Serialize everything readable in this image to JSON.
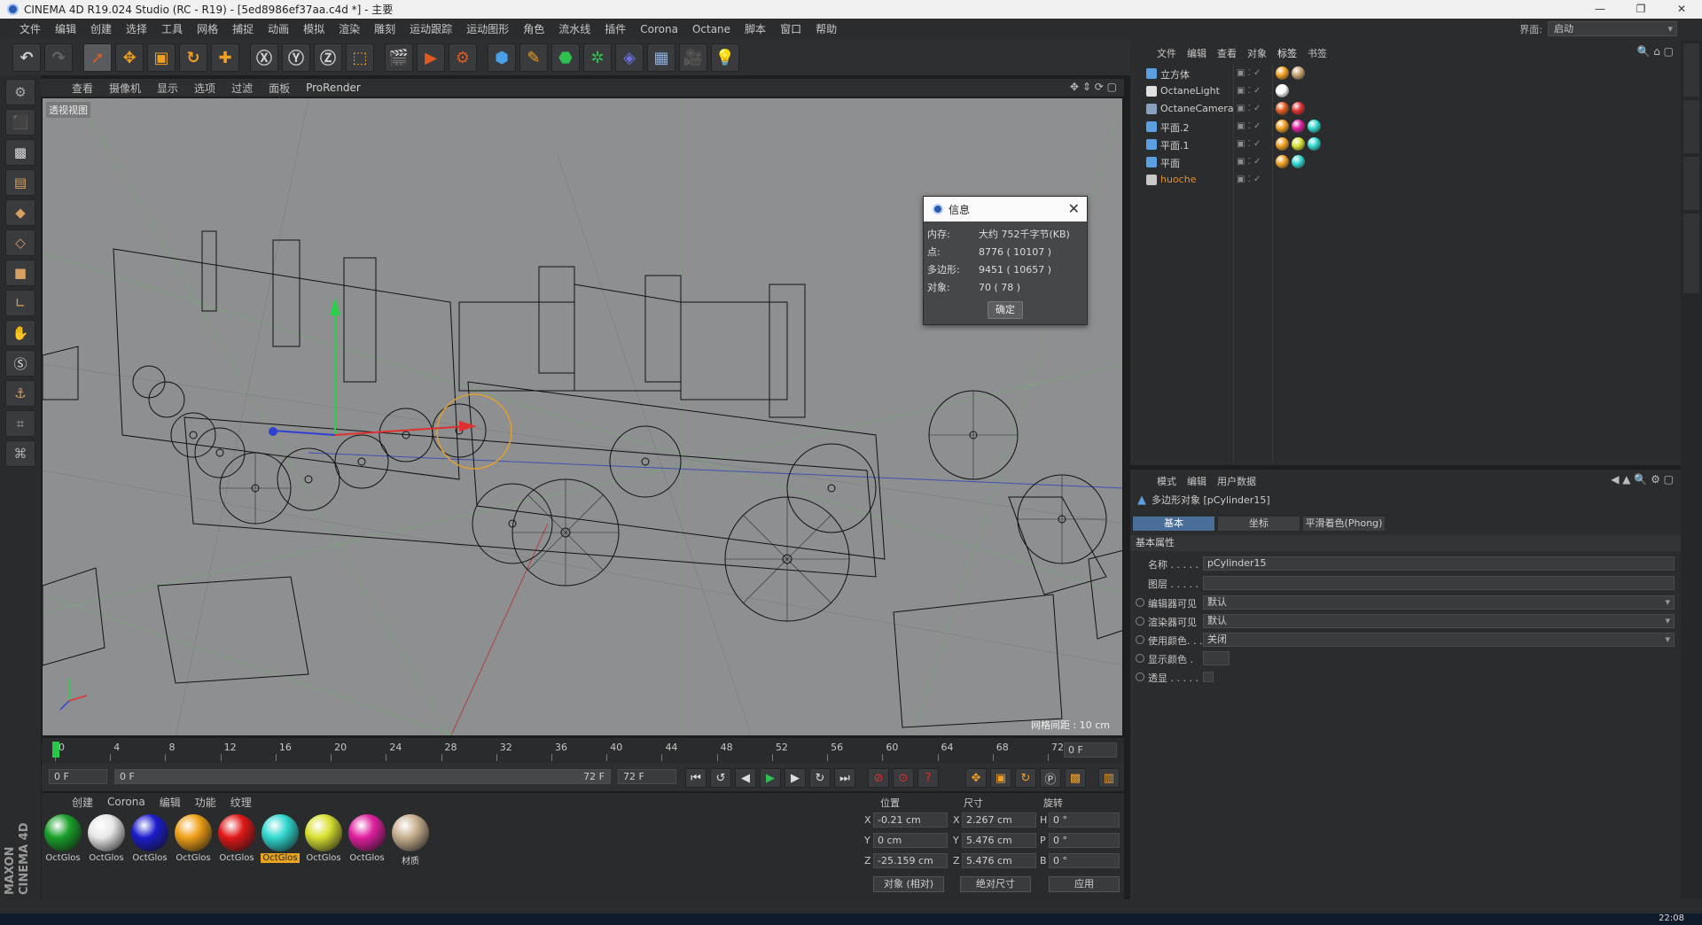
{
  "window": {
    "title": "CINEMA 4D R19.024 Studio (RC - R19) - [5ed8986ef37aa.c4d *] - 主要",
    "min": "—",
    "max": "❐",
    "close": "✕"
  },
  "menubar": {
    "items": [
      "文件",
      "编辑",
      "创建",
      "选择",
      "工具",
      "网格",
      "捕捉",
      "动画",
      "模拟",
      "渲染",
      "雕刻",
      "运动跟踪",
      "运动图形",
      "角色",
      "流水线",
      "插件",
      "Corona",
      "Octane",
      "脚本",
      "窗口",
      "帮助"
    ],
    "layout_label": "界面:",
    "layout_value": "启动"
  },
  "viewport": {
    "menu": [
      "查看",
      "摄像机",
      "显示",
      "选项",
      "过滤",
      "面板",
      "ProRender"
    ],
    "label": "透视视图",
    "grid_spacing": "网格间距 : 10 cm"
  },
  "dialog": {
    "title": "信息",
    "rows": [
      {
        "k": "内存:",
        "v": "大约 752千字节(KB)"
      },
      {
        "k": "点:",
        "v": "8776 ( 10107 )"
      },
      {
        "k": "多边形:",
        "v": "9451 ( 10657 )"
      },
      {
        "k": "对象:",
        "v": "70 ( 78 )"
      }
    ],
    "ok": "确定"
  },
  "timeline": {
    "ticks": [
      "0",
      "4",
      "8",
      "12",
      "16",
      "20",
      "24",
      "28",
      "32",
      "36",
      "40",
      "44",
      "48",
      "52",
      "56",
      "60",
      "64",
      "68",
      "72"
    ],
    "current_frame": "0 F",
    "start": "0 F",
    "range_start": "0 F",
    "range_end": "72 F",
    "end": "72 F"
  },
  "materials": {
    "menu": [
      "创建",
      "Corona",
      "编辑",
      "功能",
      "纹理"
    ],
    "items": [
      {
        "label": "OctGlos",
        "color": "#19a02a"
      },
      {
        "label": "OctGlos",
        "color": "#e8e8e8"
      },
      {
        "label": "OctGlos",
        "color": "#1c1ccc"
      },
      {
        "label": "OctGlos",
        "color": "#f0a018"
      },
      {
        "label": "OctGlos",
        "color": "#e01818"
      },
      {
        "label": "OctGlos",
        "color": "#30d8d0",
        "selected": true
      },
      {
        "label": "OctGlos",
        "color": "#d8e030"
      },
      {
        "label": "OctGlos",
        "color": "#e020a0"
      },
      {
        "label": "材质",
        "color": "#c8b090"
      }
    ]
  },
  "coords": {
    "headers": [
      "位置",
      "尺寸",
      "旋转"
    ],
    "rows": [
      {
        "a": "X",
        "pos": "-0.21 cm",
        "b": "X",
        "size": "2.267 cm",
        "c": "H",
        "rot": "0 °"
      },
      {
        "a": "Y",
        "pos": "0 cm",
        "b": "Y",
        "size": "5.476 cm",
        "c": "P",
        "rot": "0 °"
      },
      {
        "a": "Z",
        "pos": "-25.159 cm",
        "b": "Z",
        "size": "5.476 cm",
        "c": "B",
        "rot": "0 °"
      }
    ],
    "mode": "对象 (相对)",
    "size_mode": "绝对尺寸",
    "apply": "应用"
  },
  "objects": {
    "menu": [
      "文件",
      "编辑",
      "查看",
      "对象",
      "标签",
      "书签"
    ],
    "rows": [
      {
        "name": "立方体",
        "color": "#5aa0e0"
      },
      {
        "name": "OctaneLight",
        "color": "#e0e0e0"
      },
      {
        "name": "OctaneCamera",
        "color": "#8aa0c0"
      },
      {
        "name": "平面.2",
        "color": "#5aa0e0"
      },
      {
        "name": "平面.1",
        "color": "#5aa0e0"
      },
      {
        "name": "平面",
        "color": "#5aa0e0"
      },
      {
        "name": "huoche",
        "color": "#c8c8c8",
        "highlight": "#e09030"
      }
    ]
  },
  "attributes": {
    "menu": [
      "模式",
      "编辑",
      "用户数据"
    ],
    "object": "多边形对象 [pCylinder15]",
    "tabs": [
      "基本",
      "坐标",
      "平滑着色(Phong)"
    ],
    "section": "基本属性",
    "rows": [
      {
        "label": "名称 . . . . .",
        "value": "pCylinder15"
      },
      {
        "label": "图层 . . . . .",
        "value": ""
      },
      {
        "label": "编辑器可见",
        "value": "默认"
      },
      {
        "label": "渲染器可见",
        "value": "默认"
      },
      {
        "label": "使用颜色. . .",
        "value": "关闭"
      },
      {
        "label": "显示颜色 .",
        "value": ""
      },
      {
        "label": "透显 . . . . .",
        "value": ""
      }
    ]
  },
  "brand": "MAXON CINEMA 4D",
  "clock": "22:08"
}
